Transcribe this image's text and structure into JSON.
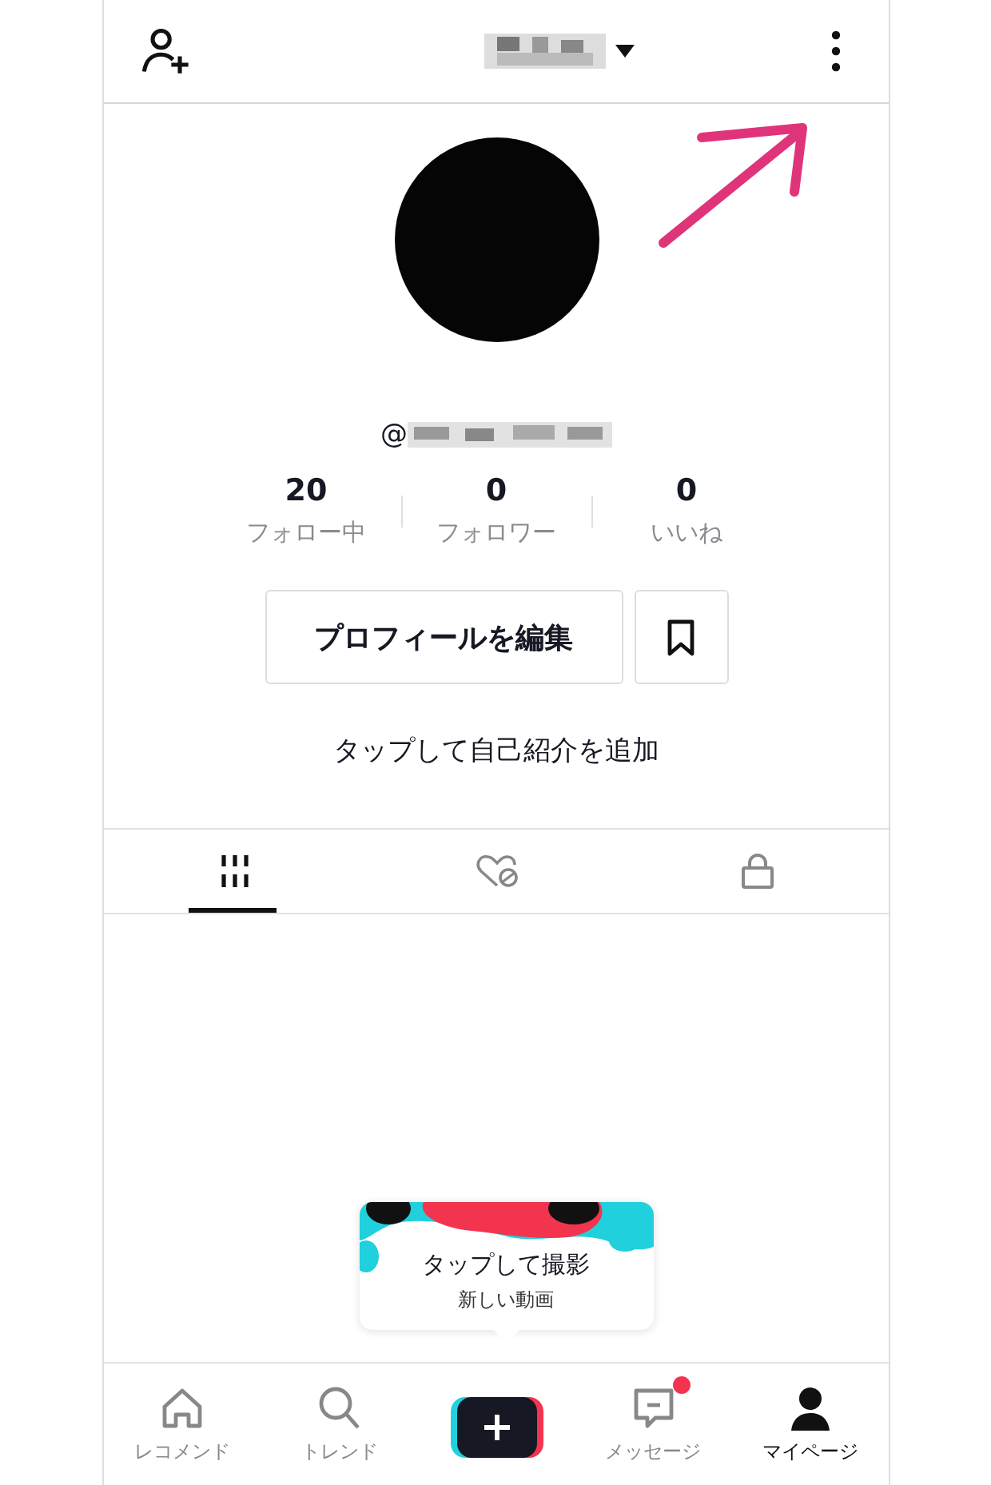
{
  "profile": {
    "handle_prefix": "@",
    "stats": [
      {
        "value": "20",
        "label": "フォロー中"
      },
      {
        "value": "0",
        "label": "フォロワー"
      },
      {
        "value": "0",
        "label": "いいね"
      }
    ],
    "edit_button": "プロフィールを編集",
    "bio_hint": "タップして自己紹介を追加"
  },
  "tabs": [
    {
      "kind": "videos",
      "selected": true
    },
    {
      "kind": "liked",
      "selected": false
    },
    {
      "kind": "private",
      "selected": false
    }
  ],
  "popup": {
    "title": "タップして撮影",
    "subtitle": "新しい動画"
  },
  "nav": [
    {
      "kind": "home",
      "label": "レコメンド",
      "selected": false,
      "badge": false
    },
    {
      "kind": "search",
      "label": "トレンド",
      "selected": false,
      "badge": false
    },
    {
      "kind": "create"
    },
    {
      "kind": "inbox",
      "label": "メッセージ",
      "selected": false,
      "badge": true
    },
    {
      "kind": "profile",
      "label": "マイページ",
      "selected": true,
      "badge": false
    }
  ]
}
